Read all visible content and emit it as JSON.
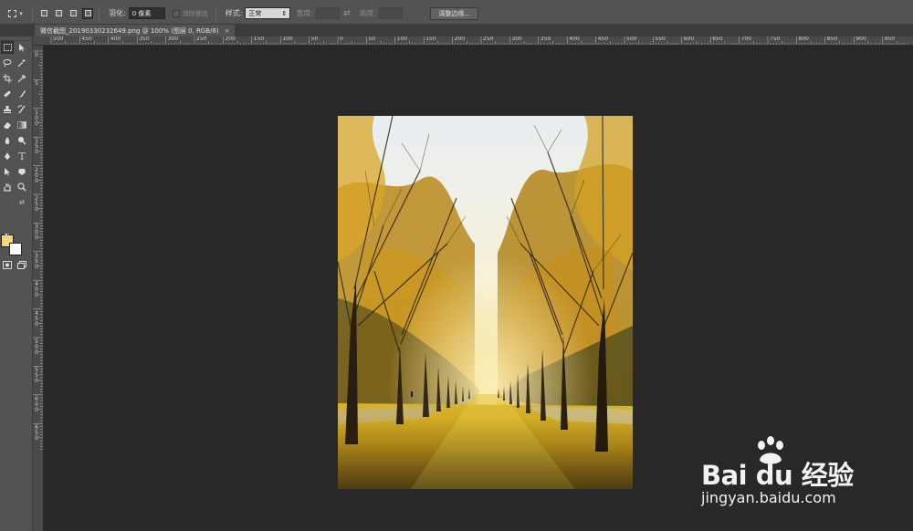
{
  "options_bar": {
    "feather_label": "羽化:",
    "feather_value": "0 像素",
    "antialias_label": "消除锯齿",
    "style_label": "样式:",
    "style_value": "正常",
    "width_label": "宽度:",
    "height_label": "高度:",
    "refine_edge_label": "调整边缘..."
  },
  "document_tab": {
    "title": "微信截图_20190330232649.png @ 100% (图层 0, RGB/8)",
    "close_label": "×"
  },
  "ruler_top_labels": [
    "500",
    "450",
    "400",
    "350",
    "300",
    "250",
    "200",
    "150",
    "100",
    "50",
    "0",
    "50",
    "100",
    "150",
    "200",
    "250",
    "300",
    "350",
    "400",
    "450",
    "500",
    "550",
    "600",
    "650",
    "700",
    "750",
    "800",
    "850",
    "900",
    "950"
  ],
  "ruler_left_labels": [
    "0",
    "5",
    "1 0 0",
    "1 5 0",
    "2 0 0",
    "2 5 0",
    "3 0 0",
    "3 5 0",
    "4 0 0",
    "4 5 0",
    "5 0 0",
    "5 5 0",
    "6 0 0",
    "6 5 0"
  ],
  "colors": {
    "foreground": "#f5d77a",
    "background": "#ffffff"
  },
  "watermark": {
    "brand": "Bai du 经验",
    "url": "jingyan.baidu.com"
  },
  "toolbox_icons": [
    "marquee-icon",
    "move-icon",
    "lasso-icon",
    "magic-wand-icon",
    "crop-icon",
    "eyedropper-icon",
    "healing-brush-icon",
    "brush-icon",
    "clone-stamp-icon",
    "history-brush-icon",
    "eraser-icon",
    "gradient-icon",
    "blur-icon",
    "dodge-icon",
    "pen-icon",
    "type-icon",
    "path-selection-icon",
    "shape-icon",
    "hand-icon",
    "zoom-icon"
  ]
}
